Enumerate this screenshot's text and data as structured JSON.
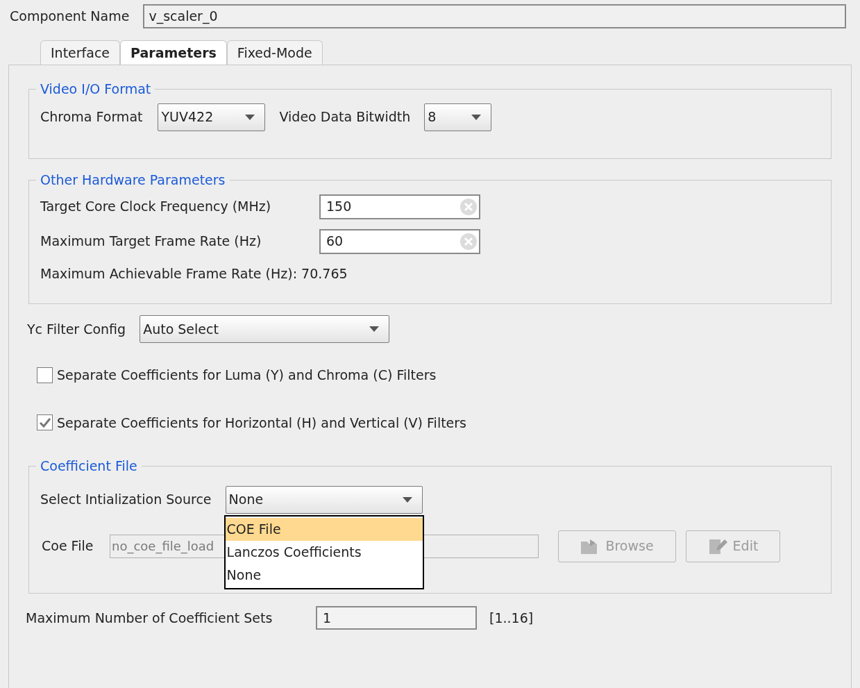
{
  "component_name": {
    "label": "Component Name",
    "value": "v_scaler_0"
  },
  "tabs": [
    {
      "label": "Interface",
      "selected": false
    },
    {
      "label": "Parameters",
      "selected": true
    },
    {
      "label": "Fixed-Mode",
      "selected": false
    }
  ],
  "video_io": {
    "title": "Video I/O Format",
    "chroma_label": "Chroma Format",
    "chroma_value": "YUV422",
    "bitwidth_label": "Video Data Bitwidth",
    "bitwidth_value": "8"
  },
  "hardware": {
    "title": "Other Hardware Parameters",
    "fields": [
      {
        "label": "Target Core Clock Frequency (MHz)",
        "value": "150"
      },
      {
        "label": "Maximum Target Frame Rate (Hz)",
        "value": "60"
      }
    ],
    "achievable": "Maximum Achievable Frame Rate (Hz): 70.765"
  },
  "yc_filter": {
    "label": "Yc Filter Config",
    "value": "Auto Select"
  },
  "checkboxes": [
    {
      "label": "Separate Coefficients for Luma (Y) and Chroma (C) Filters",
      "checked": false
    },
    {
      "label": "Separate Coefficients for Horizontal (H) and Vertical (V) Filters",
      "checked": true
    }
  ],
  "coefficient_file": {
    "title": "Coefficient File",
    "source_label": "Select Intialization Source",
    "source_value": "None",
    "options": [
      {
        "label": "COE File",
        "selected": true
      },
      {
        "label": "Lanczos Coefficients",
        "selected": false
      },
      {
        "label": "None",
        "selected": false
      }
    ],
    "coe_label": "Coe File",
    "coe_value": "no_coe_file_load",
    "coe_disabled": true,
    "buttons": [
      {
        "label": "Browse",
        "kind": "browse",
        "disabled": true
      },
      {
        "label": "Edit",
        "kind": "edit",
        "disabled": true
      }
    ]
  },
  "coefficient_sets": {
    "label": "Maximum Number of Coefficient Sets",
    "value": "1",
    "range": "[1..16]"
  }
}
